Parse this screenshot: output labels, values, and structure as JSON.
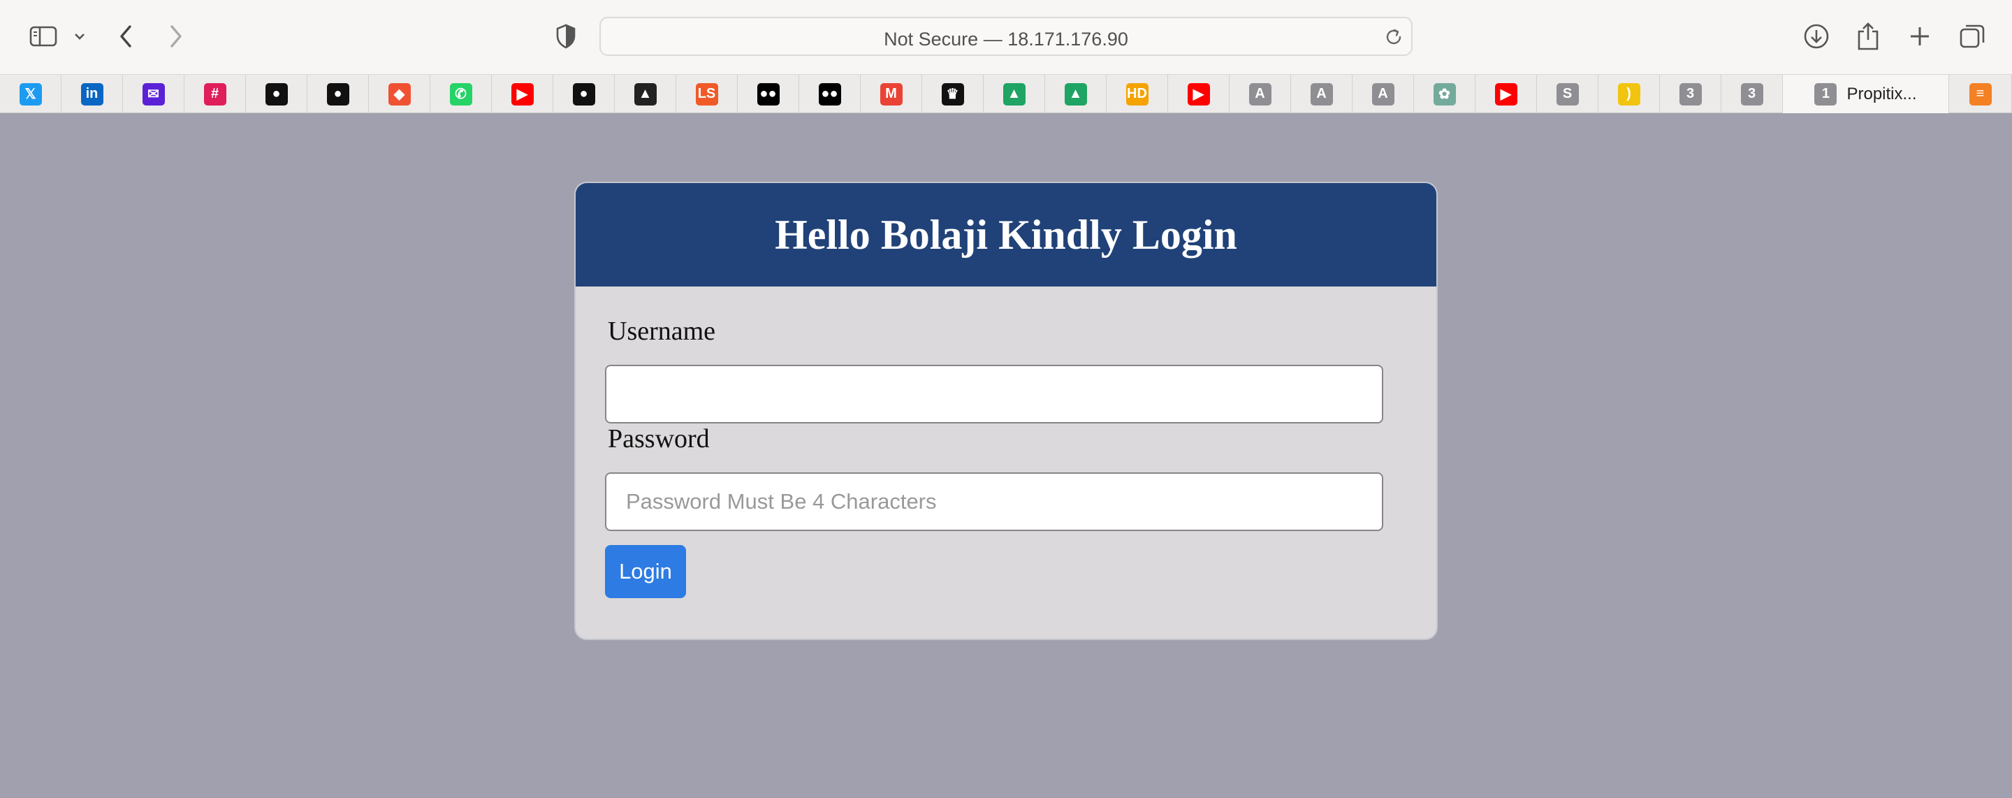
{
  "browser": {
    "address": "Not Secure — 18.171.176.90"
  },
  "tabs": [
    {
      "icon": "x-icon",
      "text": "𝕏",
      "color": "#1d9bf0"
    },
    {
      "icon": "linkedin-icon",
      "text": "in",
      "color": "#0a66c2"
    },
    {
      "icon": "mail-icon",
      "text": "✉",
      "color": "#5b21d6"
    },
    {
      "icon": "slack-icon",
      "text": "#",
      "color": "#e01e5a"
    },
    {
      "icon": "github-icon",
      "text": "●",
      "color": "#111111"
    },
    {
      "icon": "github-icon",
      "text": "●",
      "color": "#111111"
    },
    {
      "icon": "git-icon",
      "text": "◆",
      "color": "#f05133"
    },
    {
      "icon": "whatsapp-icon",
      "text": "✆",
      "color": "#25d366"
    },
    {
      "icon": "youtube-icon",
      "text": "▶",
      "color": "#ff0000"
    },
    {
      "icon": "github-icon",
      "text": "●",
      "color": "#111111"
    },
    {
      "icon": "mountain-icon",
      "text": "▲",
      "color": "#222222"
    },
    {
      "icon": "ls-icon",
      "text": "LS",
      "color": "#f05a28"
    },
    {
      "icon": "medium-icon",
      "text": "●●",
      "color": "#000000"
    },
    {
      "icon": "medium-icon",
      "text": "●●",
      "color": "#000000"
    },
    {
      "icon": "gmail-icon",
      "text": "M",
      "color": "#ea4335"
    },
    {
      "icon": "crown-icon",
      "text": "♛",
      "color": "#111111"
    },
    {
      "icon": "google-drive-icon",
      "text": "▲",
      "color": "#1fa463"
    },
    {
      "icon": "google-drive-icon",
      "text": "▲",
      "color": "#1fa463"
    },
    {
      "icon": "hd-icon",
      "text": "HD",
      "color": "#f4a300"
    },
    {
      "icon": "youtube-icon",
      "text": "▶",
      "color": "#ff0000"
    },
    {
      "icon": "letter-a-icon",
      "text": "A",
      "color": "#8e8e93"
    },
    {
      "icon": "letter-a-icon",
      "text": "A",
      "color": "#8e8e93"
    },
    {
      "icon": "letter-a-icon",
      "text": "A",
      "color": "#8e8e93"
    },
    {
      "icon": "chatgpt-icon",
      "text": "✿",
      "color": "#74aa9c"
    },
    {
      "icon": "youtube-icon",
      "text": "▶",
      "color": "#ff0000"
    },
    {
      "icon": "letter-s-icon",
      "text": "S",
      "color": "#8e8e93"
    },
    {
      "icon": "bracket-icon",
      "text": ")",
      "color": "#f1c40f"
    },
    {
      "icon": "number-3-icon",
      "text": "3",
      "color": "#8e8e93"
    },
    {
      "icon": "number-3-icon",
      "text": "3",
      "color": "#8e8e93"
    }
  ],
  "active_tab": {
    "icon_text": "1",
    "title": "Propitix...",
    "color": "#8e8e93"
  },
  "last_tab": {
    "icon": "stackoverflow-icon",
    "text": "≡",
    "color": "#f48024"
  },
  "login": {
    "title": "Hello Bolaji Kindly Login",
    "username_label": "Username",
    "username_value": "",
    "password_label": "Password",
    "password_placeholder": "Password Must Be 4 Characters",
    "button_label": "Login"
  },
  "colors": {
    "page_background": "#a0a0ae",
    "header_background": "#204278",
    "card_background": "#dbd9db",
    "button_background": "#2d7be3"
  }
}
